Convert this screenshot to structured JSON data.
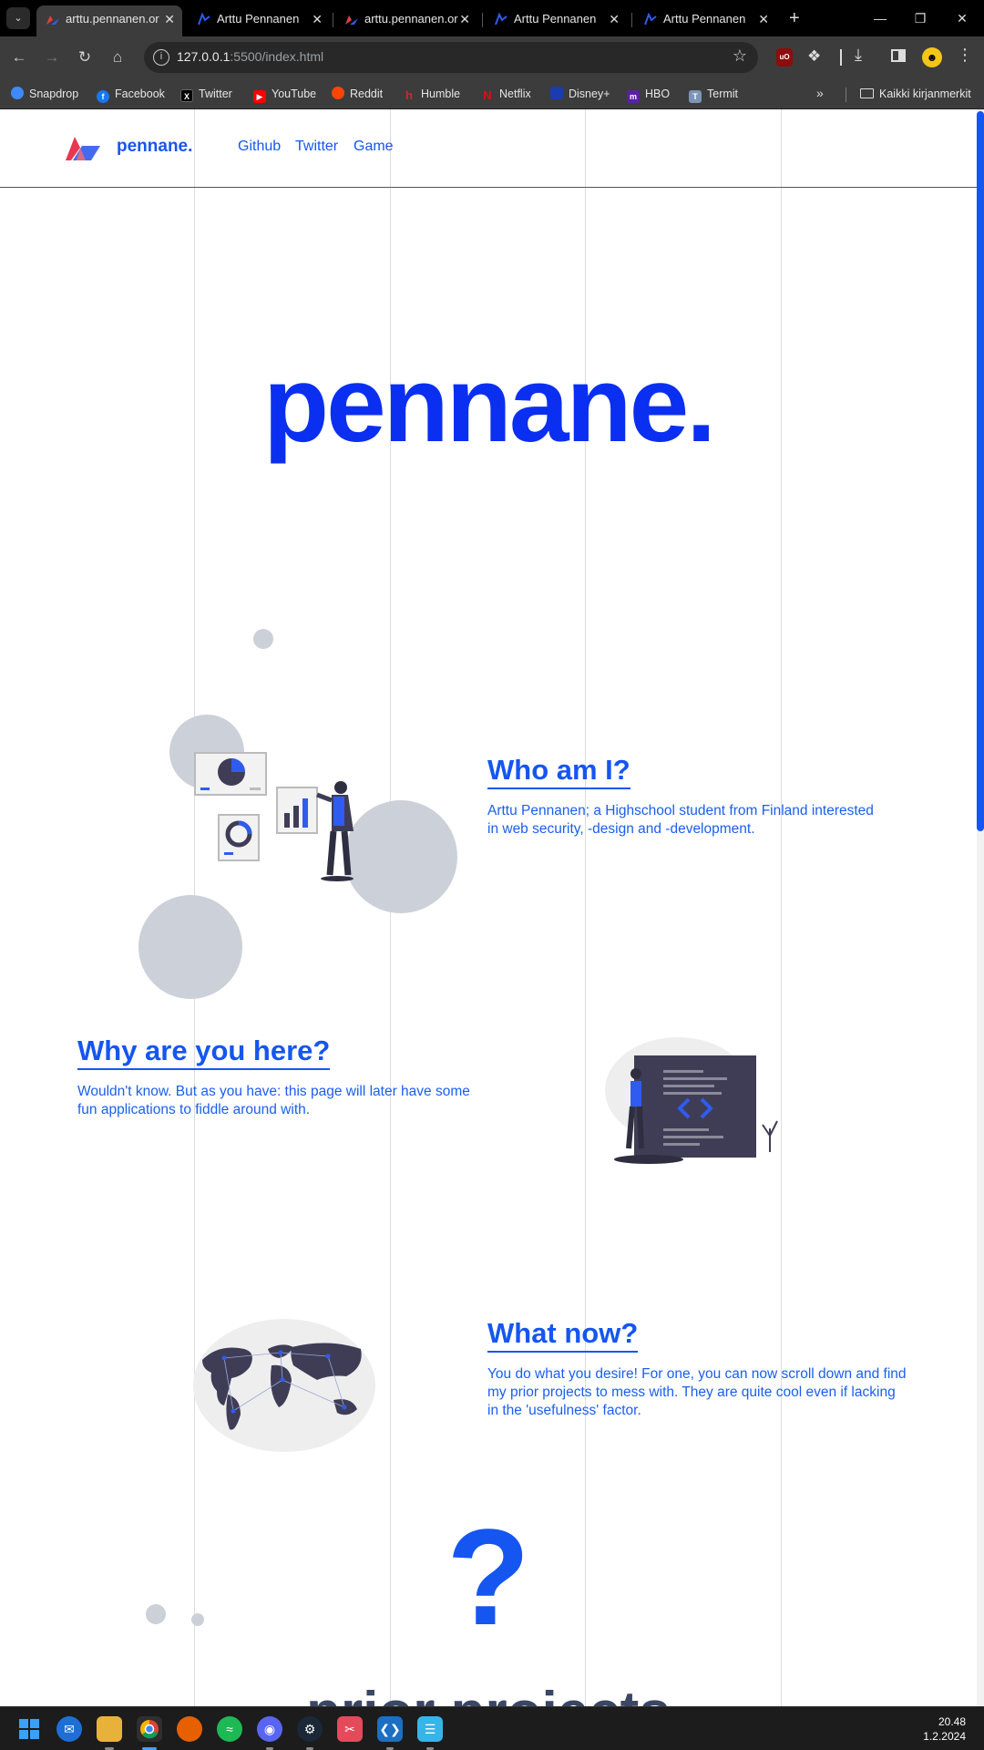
{
  "browser": {
    "tabs": [
      {
        "title": "arttu.pennanen.or",
        "active": true
      },
      {
        "title": "Arttu Pennanen",
        "active": false
      },
      {
        "title": "arttu.pennanen.or",
        "active": false
      },
      {
        "title": "Arttu Pennanen",
        "active": false
      },
      {
        "title": "Arttu Pennanen",
        "active": false
      }
    ],
    "url_host": "127.0.0.1",
    "url_rest": ":5500/index.html",
    "bookmarks": [
      {
        "label": "Snapdrop",
        "icon": "snapdrop-icon",
        "color": "#3d8bff"
      },
      {
        "label": "Facebook",
        "icon": "facebook-icon",
        "color": "#1877f2"
      },
      {
        "label": "Twitter",
        "icon": "x-icon",
        "color": "#000000"
      },
      {
        "label": "YouTube",
        "icon": "youtube-icon",
        "color": "#ff0000"
      },
      {
        "label": "Reddit",
        "icon": "reddit-icon",
        "color": "#ff4500"
      },
      {
        "label": "Humble",
        "icon": "humble-icon",
        "color": "#cc2929"
      },
      {
        "label": "Netflix",
        "icon": "netflix-icon",
        "color": "#e50914"
      },
      {
        "label": "Disney+",
        "icon": "disney-icon",
        "color": "#1a3cb0"
      },
      {
        "label": "HBO",
        "icon": "hbo-icon",
        "color": "#5b1fa8"
      },
      {
        "label": "Termit",
        "icon": "termit-icon",
        "color": "#7d95b5"
      }
    ],
    "bookmarks_folder": "Kaikki kirjanmerkit"
  },
  "site": {
    "logo_text": "pennane.",
    "nav": [
      "Github",
      "Twitter",
      "Game"
    ],
    "hero": "pennane.",
    "sections": [
      {
        "title": "Who am I?",
        "body": "Arttu Pennanen; a Highschool student from Finland interested in web security, -design and -development."
      },
      {
        "title": "Why are you here?",
        "body": "Wouldn't know. But as you have: this page will later have some fun applications to fiddle around with."
      },
      {
        "title": "What now?",
        "body": "You do what you desire! For one, you can now scroll down and find my prior projects to mess with. They are quite cool even if lacking in the 'usefulness' factor."
      }
    ],
    "question_mark": "?",
    "prior_heading": "prior projects"
  },
  "colors": {
    "accent": "#1556f0",
    "hero": "#0b2ff0",
    "circle": "#ccd0d9"
  },
  "taskbar": {
    "apps": [
      "windows-start-icon",
      "outlook-icon",
      "file-explorer-icon",
      "chrome-icon",
      "firefox-icon",
      "spotify-icon",
      "discord-icon",
      "steam-icon",
      "snipping-tool-icon",
      "vscode-icon",
      "notepad-icon"
    ],
    "time": "20.48",
    "date": "1.2.2024"
  }
}
